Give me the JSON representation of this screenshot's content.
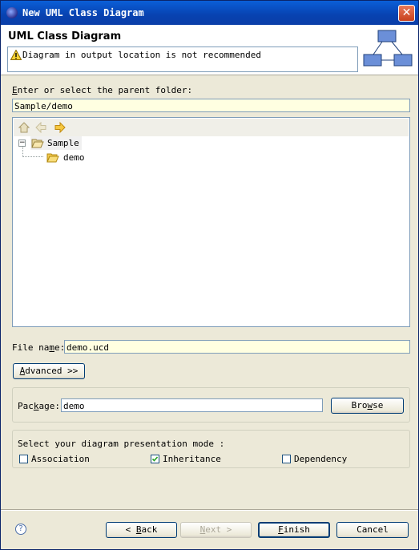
{
  "window": {
    "title": "New UML Class Diagram",
    "close_symbol": "✕"
  },
  "header": {
    "title": "UML Class Diagram",
    "message": "Diagram in output location is not recommended"
  },
  "folder": {
    "label_first": "E",
    "label_rest": "nter or select the parent folder:",
    "value": "Sample/demo"
  },
  "tree": {
    "root": {
      "label": "Sample",
      "expander": "−"
    },
    "child": {
      "label": "demo"
    }
  },
  "file": {
    "label_a": "File na",
    "label_u": "m",
    "label_b": "e:",
    "value": "demo.ucd"
  },
  "advanced": {
    "label_u": "A",
    "label_rest": "dvanced >>"
  },
  "package": {
    "label_a": "Pac",
    "label_u": "k",
    "label_b": "age:",
    "value": "demo"
  },
  "browse": {
    "label_a": "Bro",
    "label_u": "w",
    "label_b": "se"
  },
  "mode": {
    "label": "Select your diagram presentation mode :",
    "options": [
      {
        "label": "Association",
        "checked": false
      },
      {
        "label": "Inheritance",
        "checked": true
      },
      {
        "label": "Dependency",
        "checked": false
      }
    ]
  },
  "footer": {
    "back": {
      "prefix": "< ",
      "u": "B",
      "rest": "ack"
    },
    "next": {
      "u": "N",
      "rest": "ext >"
    },
    "finish": {
      "u": "F",
      "rest": "inish"
    },
    "cancel": "Cancel",
    "help_symbol": "?"
  },
  "colors": {
    "title_bar": "#0842b0",
    "field_bg": "#ffffe1",
    "dialog_bg": "#ece9d8"
  }
}
